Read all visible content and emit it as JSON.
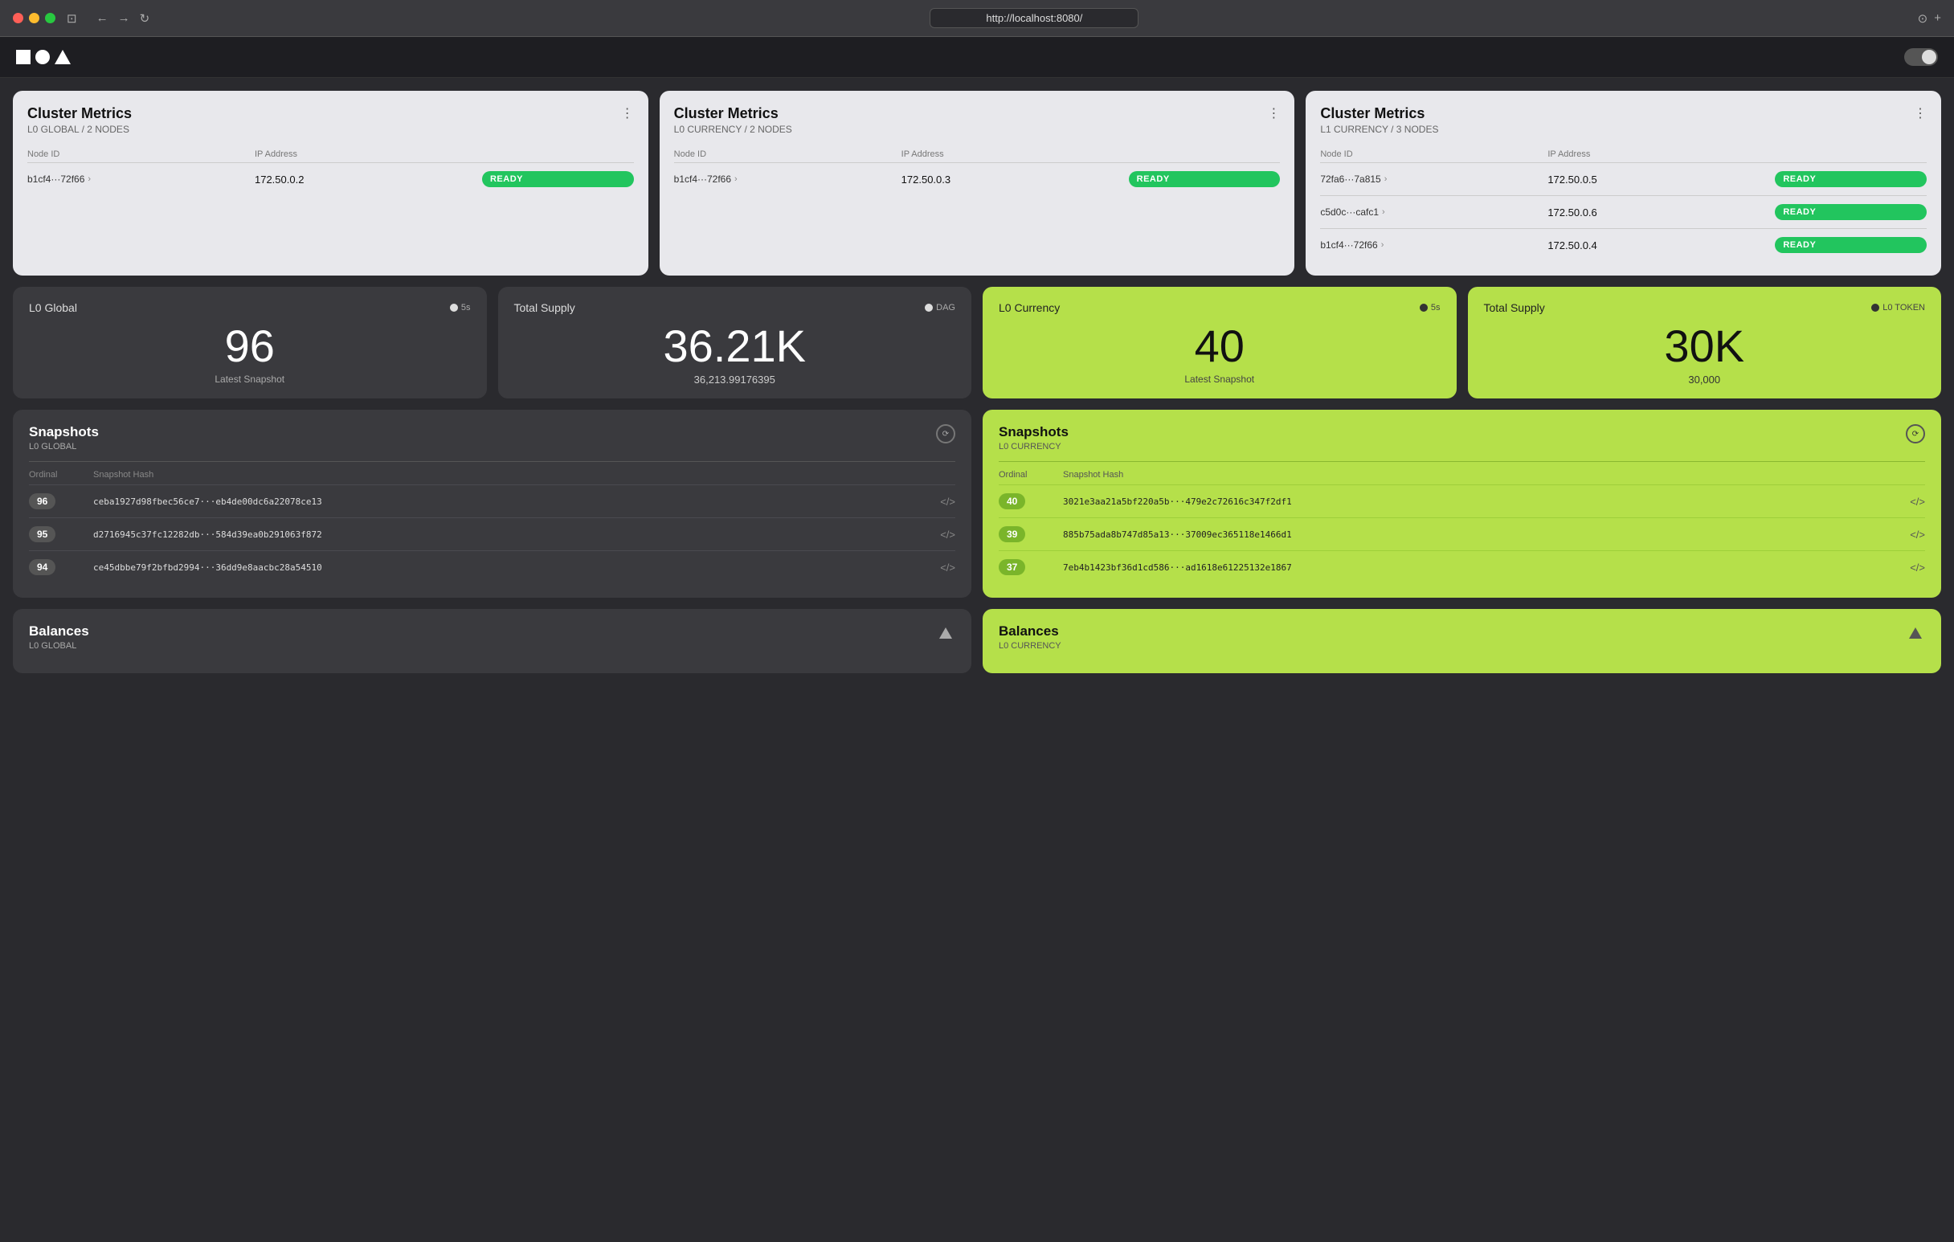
{
  "browser": {
    "url": "http://localhost:8080/",
    "back_label": "←",
    "forward_label": "→",
    "refresh_label": "↻",
    "sidebar_label": "⊡",
    "download_label": "⊙",
    "new_tab_label": "+"
  },
  "app": {
    "toggle_label": ""
  },
  "cluster_metrics": [
    {
      "title": "Cluster Metrics",
      "subtitle": "L0 GLOBAL  /  2 NODES",
      "more_label": "⋮",
      "col_node_id": "Node ID",
      "col_ip": "IP Address",
      "nodes": [
        {
          "id": "b1cf4···72f66",
          "ip": "172.50.0.2",
          "status": "READY"
        }
      ]
    },
    {
      "title": "Cluster Metrics",
      "subtitle": "L0 CURRENCY  /  2 NODES",
      "more_label": "⋮",
      "col_node_id": "Node ID",
      "col_ip": "IP Address",
      "nodes": [
        {
          "id": "b1cf4···72f66",
          "ip": "172.50.0.3",
          "status": "READY"
        }
      ]
    },
    {
      "title": "Cluster Metrics",
      "subtitle": "L1 CURRENCY  /  3 NODES",
      "more_label": "⋮",
      "col_node_id": "Node ID",
      "col_ip": "IP Address",
      "nodes": [
        {
          "id": "72fa6···7a815",
          "ip": "172.50.0.5",
          "status": "READY"
        },
        {
          "id": "c5d0c···cafc1",
          "ip": "172.50.0.6",
          "status": "READY"
        },
        {
          "id": "b1cf4···72f66",
          "ip": "172.50.0.4",
          "status": "READY"
        }
      ]
    }
  ],
  "metrics": [
    {
      "theme": "dark",
      "label": "L0 Global",
      "badge": "5s",
      "value": "96",
      "sub": "Latest Snapshot",
      "sub_value": ""
    },
    {
      "theme": "dark",
      "label": "Total Supply",
      "badge": "DAG",
      "value": "36.21K",
      "sub": "",
      "sub_value": "36,213.99176395"
    },
    {
      "theme": "lime",
      "label": "L0 Currency",
      "badge": "5s",
      "value": "40",
      "sub": "Latest Snapshot",
      "sub_value": ""
    },
    {
      "theme": "lime",
      "label": "Total Supply",
      "badge": "L0 TOKEN",
      "value": "30K",
      "sub": "",
      "sub_value": "30,000"
    }
  ],
  "snapshots": [
    {
      "theme": "dark",
      "title": "Snapshots",
      "subtitle": "L0 GLOBAL",
      "col_ordinal": "Ordinal",
      "col_hash": "Snapshot Hash",
      "rows": [
        {
          "ordinal": "96",
          "hash": "ceba1927d98fbec56ce7···eb4de00dc6a22078ce13"
        },
        {
          "ordinal": "95",
          "hash": "d2716945c37fc12282db···584d39ea0b291063f872"
        },
        {
          "ordinal": "94",
          "hash": "ce45dbbe79f2bfbd2994···36dd9e8aacbc28a54510"
        }
      ]
    },
    {
      "theme": "lime",
      "title": "Snapshots",
      "subtitle": "L0 CURRENCY",
      "col_ordinal": "Ordinal",
      "col_hash": "Snapshot Hash",
      "rows": [
        {
          "ordinal": "40",
          "hash": "3021e3aa21a5bf220a5b···479e2c72616c347f2df1"
        },
        {
          "ordinal": "39",
          "hash": "885b75ada8b747d85a13···37009ec365118e1466d1"
        },
        {
          "ordinal": "37",
          "hash": "7eb4b1423bf36d1cd586···ad1618e61225132e1867"
        }
      ]
    }
  ],
  "balances": [
    {
      "theme": "dark",
      "title": "Balances",
      "subtitle": "L0 GLOBAL"
    },
    {
      "theme": "lime",
      "title": "Balances",
      "subtitle": "L0 CURRENCY"
    }
  ]
}
